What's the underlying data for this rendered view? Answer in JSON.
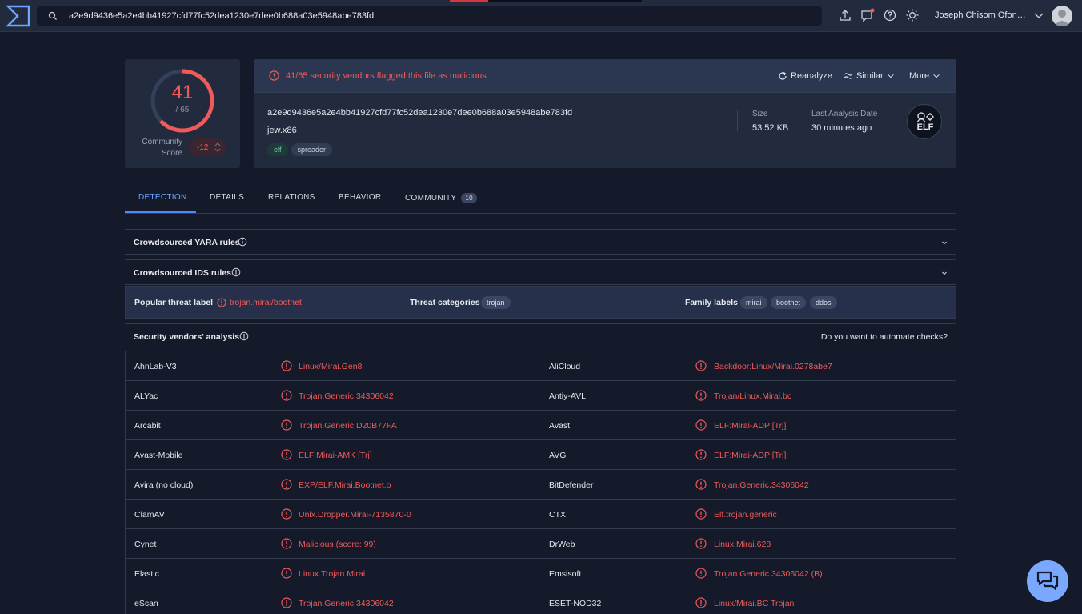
{
  "search": {
    "value": "a2e9d9436e5a2e4bb41927cfd77fc52dea1230e7dee0b688a03e5948abe783fd"
  },
  "user": {
    "name": "Joseph Chisom Ofonag..."
  },
  "score": {
    "detected": "41",
    "total": "/ 65",
    "fraction": 0.63,
    "community_label_1": "Community",
    "community_label_2": "Score",
    "community_value": "-12"
  },
  "alert": {
    "text": "41/65 security vendors flagged this file as malicious",
    "reanalyze": "Reanalyze",
    "similar": "Similar",
    "more": "More"
  },
  "file": {
    "hash": "a2e9d9436e5a2e4bb41927cfd77fc52dea1230e7dee0b688a03e5948abe783fd",
    "name": "jew.x86",
    "tags": [
      "elf",
      "spreader"
    ],
    "size_label": "Size",
    "size_value": "53.52 KB",
    "date_label": "Last Analysis Date",
    "date_value": "30 minutes ago",
    "type_badge": "ELF"
  },
  "tabs": [
    {
      "label": "DETECTION"
    },
    {
      "label": "DETAILS"
    },
    {
      "label": "RELATIONS"
    },
    {
      "label": "BEHAVIOR"
    },
    {
      "label": "COMMUNITY",
      "badge": "10"
    }
  ],
  "sections": {
    "yara": "Crowdsourced YARA rules",
    "ids": "Crowdsourced IDS rules"
  },
  "threat": {
    "popular_label": "Popular threat label",
    "popular_value": "trojan.mirai/bootnet",
    "categories_label": "Threat categories",
    "categories": [
      "trojan"
    ],
    "family_label": "Family labels",
    "families": [
      "mirai",
      "bootnet",
      "ddos"
    ]
  },
  "vendors_head": {
    "title": "Security vendors' analysis",
    "automate": "Do you want to automate checks?"
  },
  "vendors": [
    {
      "left_name": "AhnLab-V3",
      "left_result": "Linux/Mirai.Gen8",
      "right_name": "AliCloud",
      "right_result": "Backdoor:Linux/Mirai.0278abe7"
    },
    {
      "left_name": "ALYac",
      "left_result": "Trojan.Generic.34306042",
      "right_name": "Antiy-AVL",
      "right_result": "Trojan/Linux.Mirai.bc"
    },
    {
      "left_name": "Arcabit",
      "left_result": "Trojan.Generic.D20B77FA",
      "right_name": "Avast",
      "right_result": "ELF:Mirai-ADP [Trj]"
    },
    {
      "left_name": "Avast-Mobile",
      "left_result": "ELF:Mirai-AMK [Trj]",
      "right_name": "AVG",
      "right_result": "ELF:Mirai-ADP [Trj]"
    },
    {
      "left_name": "Avira (no cloud)",
      "left_result": "EXP/ELF.Mirai.Bootnet.o",
      "right_name": "BitDefender",
      "right_result": "Trojan.Generic.34306042"
    },
    {
      "left_name": "ClamAV",
      "left_result": "Unix.Dropper.Mirai-7135870-0",
      "right_name": "CTX",
      "right_result": "Elf.trojan.generic"
    },
    {
      "left_name": "Cynet",
      "left_result": "Malicious (score: 99)",
      "right_name": "DrWeb",
      "right_result": "Linux.Mirai.628"
    },
    {
      "left_name": "Elastic",
      "left_result": "Linux.Trojan.Mirai",
      "right_name": "Emsisoft",
      "right_result": "Trojan.Generic.34306042 (B)"
    },
    {
      "left_name": "eScan",
      "left_result": "Trojan.Generic.34306042",
      "right_name": "ESET-NOD32",
      "right_result": "Linux/Mirai.BC Trojan"
    }
  ],
  "colors": {
    "malicious": "#f05a5a",
    "accent": "#4a8cff",
    "background": "#141a29",
    "card": "#222a3d"
  }
}
